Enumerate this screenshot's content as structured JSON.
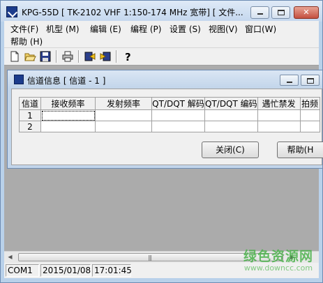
{
  "window": {
    "title": "KPG-55D  [ TK-2102 VHF 1:150-174 MHz  宽带] [ 文件..."
  },
  "menu": {
    "items": [
      "文件(F)",
      "机型 (M)",
      "编辑 (E)",
      "编程 (P)",
      "设置 (S)",
      "视图(V)",
      "窗口(W)",
      "帮助 (H)"
    ]
  },
  "toolbar": {
    "icons": [
      "new-file-icon",
      "open-folder-icon",
      "save-disk-icon",
      "print-icon",
      "read-radio-icon",
      "write-radio-icon",
      "help-question-icon"
    ]
  },
  "child_window": {
    "title": "信道信息 [ 信道 - 1 ]",
    "columns": [
      "信道",
      "接收频率",
      "发射频率",
      "QT/DQT 解码",
      "QT/DQT 编码",
      "遇忙禁发",
      "拍频"
    ],
    "rows": [
      {
        "channel": "1",
        "cells": [
          "",
          "",
          "",
          "",
          "",
          ""
        ]
      },
      {
        "channel": "2",
        "cells": [
          "",
          "",
          "",
          "",
          "",
          ""
        ]
      }
    ],
    "buttons": {
      "close": "关闭(C)",
      "help": "帮助(H"
    }
  },
  "statusbar": {
    "port": "COM1",
    "date": "2015/01/08",
    "time": "17:01:45"
  },
  "watermark": {
    "main": "绿色资源网",
    "sub": "www.downcc.com"
  },
  "colors": {
    "frame": "#b9d1ea",
    "mdi_bg": "#ababab",
    "watermark": "#4cb24c"
  }
}
